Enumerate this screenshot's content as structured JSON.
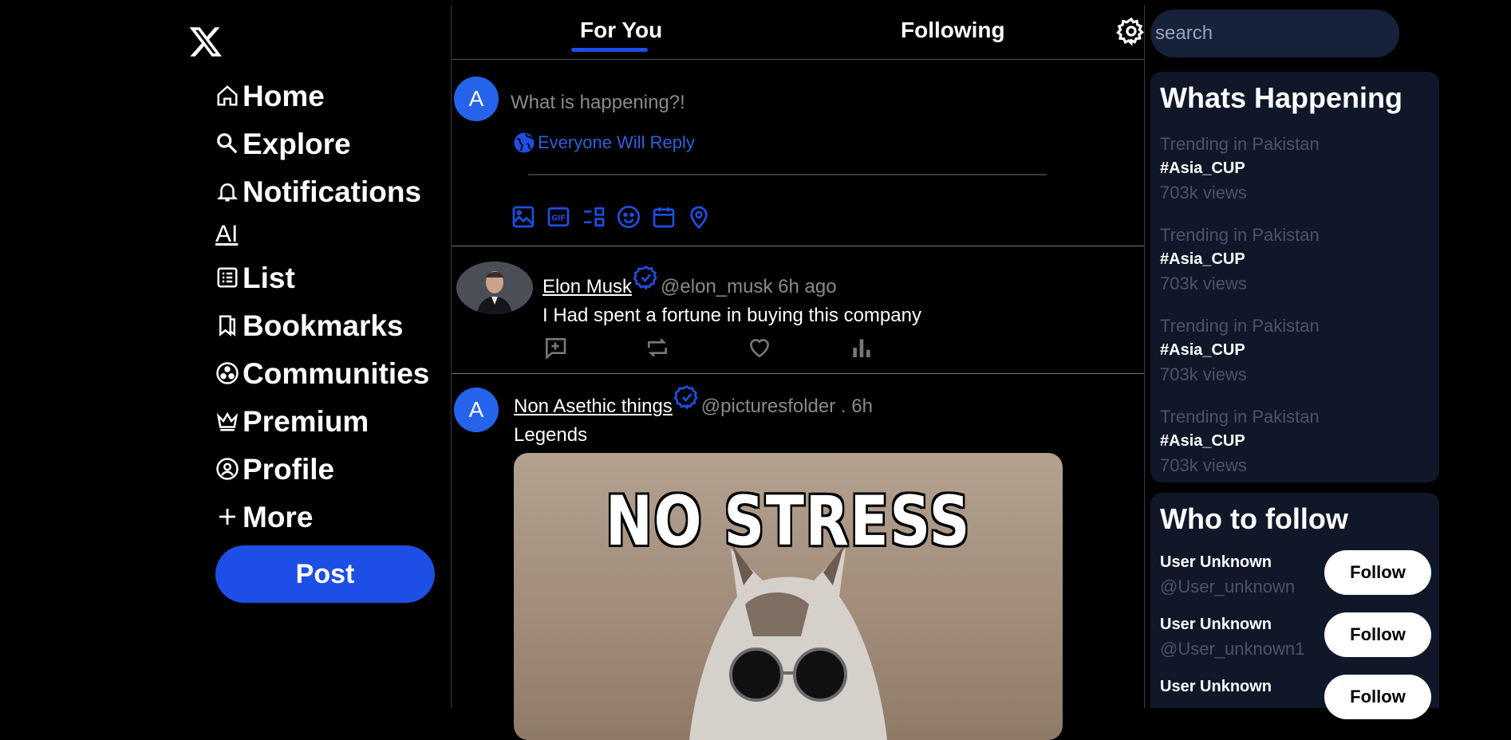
{
  "sidebar": {
    "logo": "x-logo-icon",
    "items": [
      {
        "label": "Home",
        "icon": "home-icon"
      },
      {
        "label": "Explore",
        "icon": "search-icon"
      },
      {
        "label": "Notifications",
        "icon": "bell-icon"
      },
      {
        "label": "AI",
        "icon": ""
      },
      {
        "label": "List",
        "icon": "list-icon"
      },
      {
        "label": "Bookmarks",
        "icon": "bookmark-icon"
      },
      {
        "label": "Communities",
        "icon": "communities-icon"
      },
      {
        "label": "Premium",
        "icon": "crown-icon"
      },
      {
        "label": "Profile",
        "icon": "profile-icon"
      },
      {
        "label": "More",
        "icon": "plus-icon"
      }
    ],
    "post_label": "Post"
  },
  "header": {
    "tabs": [
      {
        "label": "For You"
      },
      {
        "label": "Following"
      }
    ],
    "settings_icon": "gear-icon"
  },
  "compose": {
    "avatar_letter": "A",
    "placeholder": "What is happening?!",
    "reply_label": "Everyone Will Reply",
    "tools": [
      "image-icon",
      "gif-icon",
      "poll-icon",
      "emoji-icon",
      "schedule-icon",
      "location-icon"
    ]
  },
  "feed": [
    {
      "name": "Elon Musk",
      "meta": "@elon_musk 6h ago",
      "text": "I Had spent a fortune in buying this company",
      "actions": [
        "reply-icon",
        "retweet-icon",
        "like-icon",
        "analytics-icon"
      ]
    },
    {
      "avatar_letter": "A",
      "name": "Non Asethic things",
      "meta": "@picturesfolder . 6h",
      "text": "Legends",
      "image_text": "NO STRESS"
    }
  ],
  "search": {
    "placeholder": "search"
  },
  "trends": {
    "title": "Whats Happening",
    "items": [
      {
        "location": "Trending in Pakistan",
        "tag": "#Asia_CUP",
        "views": "703k views"
      },
      {
        "location": "Trending in Pakistan",
        "tag": "#Asia_CUP",
        "views": "703k views"
      },
      {
        "location": "Trending in Pakistan",
        "tag": "#Asia_CUP",
        "views": "703k views"
      },
      {
        "location": "Trending in Pakistan",
        "tag": "#Asia_CUP",
        "views": "703k views"
      }
    ]
  },
  "who_to_follow": {
    "title": "Who to follow",
    "users": [
      {
        "name": "User Unknown",
        "handle": "@User_unknown",
        "button": "Follow"
      },
      {
        "name": "User Unknown",
        "handle": "@User_unknown1",
        "button": "Follow"
      },
      {
        "name": "User Unknown",
        "handle": "",
        "button": "Follow"
      }
    ]
  },
  "colors": {
    "accent": "#1d4fe6",
    "avatar": "#2563eb",
    "panel": "#0f1729",
    "muted": "#4a5468"
  }
}
